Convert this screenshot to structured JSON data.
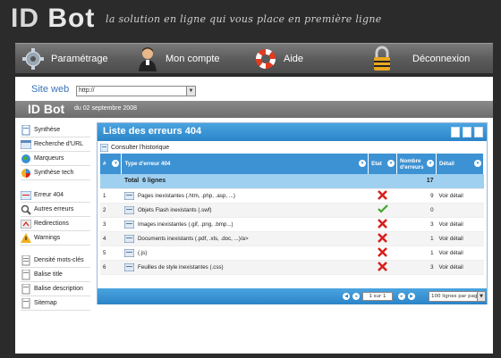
{
  "header": {
    "logo_id": "ID",
    "logo_bot": "Bot",
    "tagline": "la solution en ligne qui vous place en première ligne"
  },
  "menu": [
    {
      "label": "Paramétrage",
      "icon": "gear-icon"
    },
    {
      "label": "Mon compte",
      "icon": "user-icon"
    },
    {
      "label": "Aide",
      "icon": "lifebuoy-icon"
    },
    {
      "label": "Déconnexion",
      "icon": "padlock-icon"
    }
  ],
  "siteweb": {
    "label": "Site web",
    "value": "http://"
  },
  "title": {
    "brand": "ID Bot",
    "date": "du 02 septembre 2008"
  },
  "sidebar": {
    "group1": [
      "Synthèse",
      "Recherche d'URL",
      "Marqueurs",
      "Synthèse tech"
    ],
    "group2": [
      "Erreur 404",
      "Autres erreurs",
      "Redirections",
      "Warnings"
    ],
    "group3": [
      "Densité mots-clés",
      "Balise title",
      "Balise description",
      "Sitemap"
    ]
  },
  "panel": {
    "title": "Liste des erreurs 404",
    "historique": "Consulter l'historique",
    "columns": {
      "num": "#",
      "type": "Type d'erreur 404",
      "etat": "Etat",
      "nombre": "Nombre d'erreurs",
      "detail": "Détail"
    },
    "total_label": "Total",
    "total_lignes": "6 lignes",
    "total_count": "17",
    "rows": [
      {
        "num": "1",
        "type": "Pages inexistantes (.htm, .php, .asp, ...)",
        "etat": "error",
        "count": "9",
        "detail": "Voir détail"
      },
      {
        "num": "2",
        "type": "Objets Flash inexistants (.swf)",
        "etat": "ok",
        "count": "0",
        "detail": ""
      },
      {
        "num": "3",
        "type": "Images inexistantes (.gif, .png, .bmp...)",
        "etat": "error",
        "count": "3",
        "detail": "Voir détail"
      },
      {
        "num": "4",
        "type": "Documents inexistants (.pdf, .xls, .doc, ...)/a>",
        "etat": "error",
        "count": "1",
        "detail": "Voir détail"
      },
      {
        "num": "5",
        "type": "(.js)",
        "etat": "error",
        "count": "1",
        "detail": "Voir détail"
      },
      {
        "num": "6",
        "type": "Feuilles de style inexistantes (.css)",
        "etat": "error",
        "count": "3",
        "detail": "Voir détail"
      }
    ],
    "pager": {
      "page_text": "1 sur 1",
      "per_page": "100 lignes par page"
    }
  },
  "colors": {
    "accent_blue": "#2b84c8",
    "error_red": "#d9201c",
    "ok_green": "#3fa72a"
  }
}
